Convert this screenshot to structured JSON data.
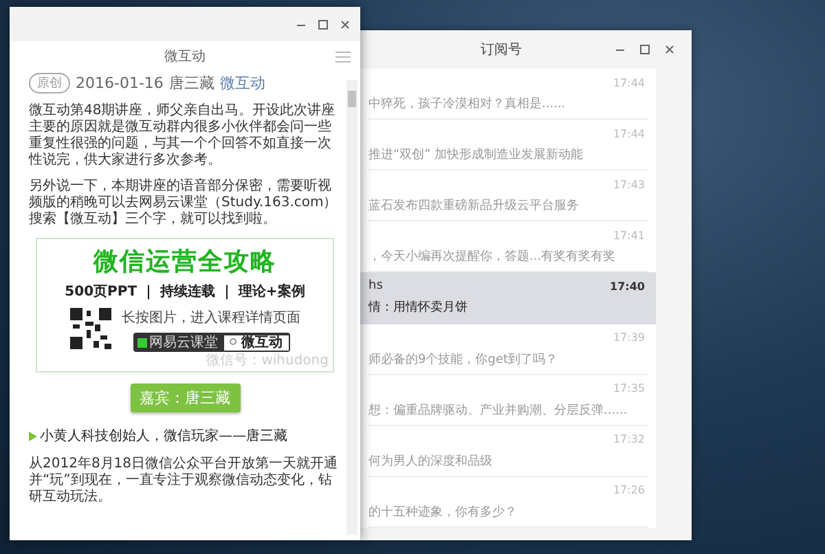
{
  "subscription_window": {
    "title": "订阅号",
    "messages": [
      {
        "snippet": "中猝死，孩子冷漠相对？真相是......",
        "time": "17:44",
        "selected": false
      },
      {
        "snippet": "推进“双创” 加快形成制造业发展新动能",
        "time": "17:44",
        "selected": false
      },
      {
        "snippet": "蓝石发布四款重磅新品升级云平台服务",
        "time": "17:43",
        "selected": false
      },
      {
        "snippet": "，今天小编再次提醒你，答题...有奖有奖有奖",
        "time": "17:41",
        "selected": false
      },
      {
        "title": "hs",
        "snippet": "情：用情怀卖月饼",
        "time": "17:40",
        "selected": true
      },
      {
        "snippet": "师必备的9个技能，你get到了吗？",
        "time": "17:39",
        "selected": false
      },
      {
        "snippet": "想：偏重品牌驱动、产业并购潮、分层反弹......",
        "time": "17:35",
        "selected": false
      },
      {
        "snippet": "何为男人的深度和品级",
        "time": "17:32",
        "selected": false
      },
      {
        "snippet": "的十五种迹象，你有多少？",
        "time": "17:26",
        "selected": false
      }
    ]
  },
  "article_window": {
    "title": "微互动",
    "tag": "原创",
    "date": "2016-01-16",
    "author": "唐三藏",
    "account": "微互动",
    "paragraphs": [
      "微互动第48期讲座，师父亲自出马。开设此次讲座主要的原因就是微互动群内很多小伙伴都会问一些重复性很强的问题，与其一个个回答不如直接一次性说完，供大家进行多次参考。",
      "另外说一下，本期讲座的语音部分保密，需要听视频版的稍晚可以去网易云课堂（Study.163.com）搜索【微互动】三个字，就可以找到啦。"
    ],
    "promo_image": {
      "headline": "微信运营全攻略",
      "subline": "500页PPT ｜ 持续连载 ｜ 理论+案例",
      "hint": "长按图片，进入课程详情页面",
      "site": "网易云课堂",
      "search_text": "微互动",
      "watermark": "微信号：wihudong"
    },
    "guest_button": "嘉宾：唐三藏",
    "bio_heading": "小黄人科技创始人，微信玩家——唐三藏",
    "bio_paragraph": "从2012年8月18日微信公众平台开放第一天就开通并“玩”到现在，一直专注于观察微信动态变化，钻研互动玩法。"
  }
}
